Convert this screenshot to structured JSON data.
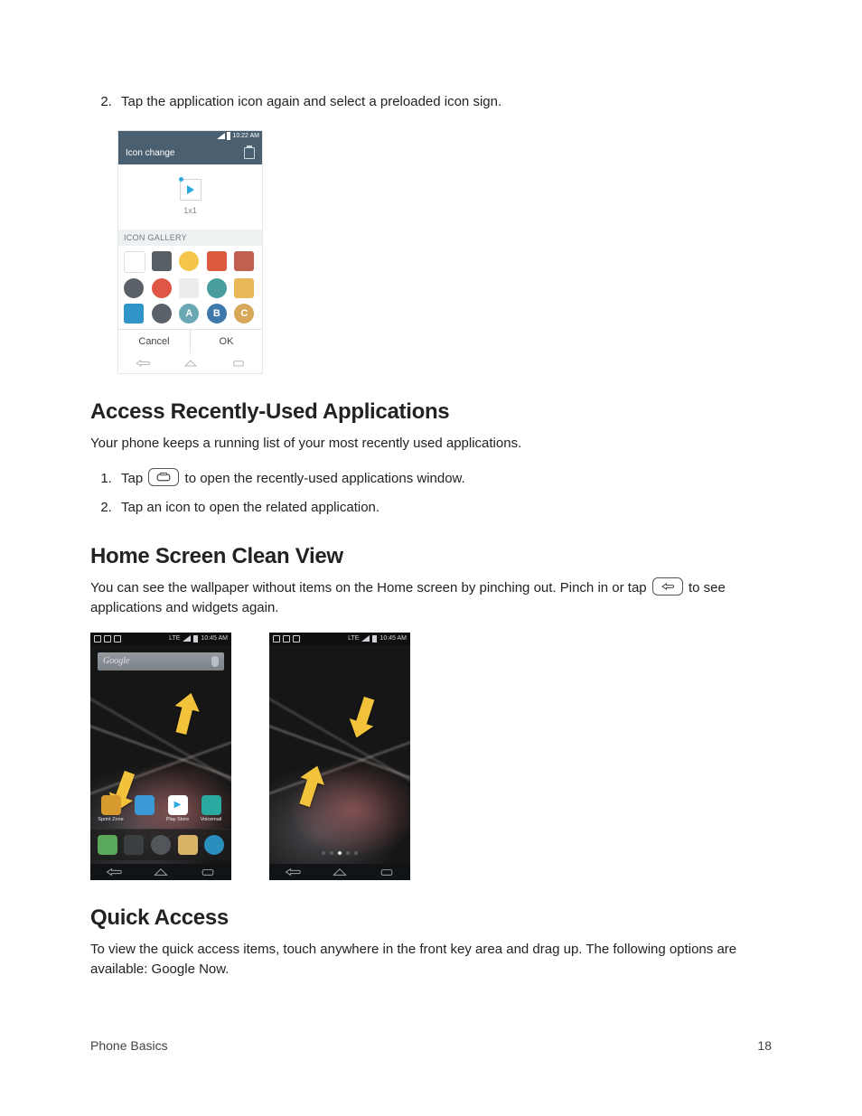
{
  "list1": {
    "start": 2,
    "item1": "Tap the application icon again and select a preloaded icon sign."
  },
  "iconChangeDialog": {
    "statusTime": "10:22 AM",
    "title": "Icon change",
    "previewSize": "1x1",
    "galleryHeader": "ICON GALLERY",
    "cancel": "Cancel",
    "ok": "OK",
    "letters": {
      "a": "A",
      "b": "B",
      "c": "C"
    }
  },
  "section1": {
    "heading": "Access Recently-Used Applications",
    "intro": "Your phone keeps a running list of your most recently used applications.",
    "step1_pre": "Tap ",
    "step1_post": " to open the recently-used applications window.",
    "step2": "Tap an icon to open the related application."
  },
  "section2": {
    "heading": "Home Screen Clean View",
    "intro_pre": "You can see the wallpaper without items on the Home screen by pinching out. Pinch in or tap ",
    "intro_post": " to see applications and widgets again."
  },
  "homeScreens": {
    "statusTime": "10:45 AM",
    "statusNet": "LTE",
    "searchLabel": "Google",
    "appLabels": {
      "sprintZone": "Sprint Zone",
      "playStore": "Play Store",
      "voicemail": "Voicemail"
    }
  },
  "section3": {
    "heading": "Quick Access",
    "intro": "To view the quick access items, touch anywhere in the front key area and drag up. The following options are available: Google Now."
  },
  "footer": {
    "left": "Phone Basics",
    "right": "18"
  }
}
